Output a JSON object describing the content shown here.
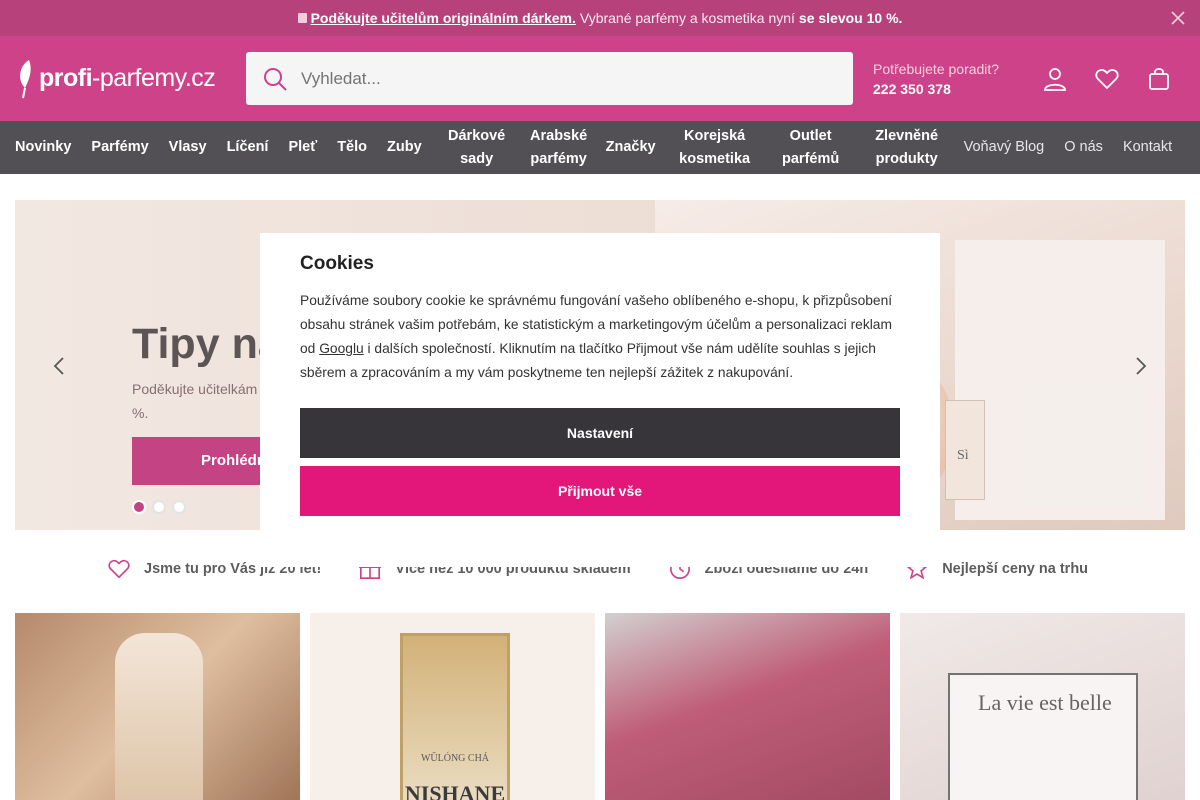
{
  "promo": {
    "lead": "Poděkujte učitelům originálním dárkem.",
    "middle": "Vybrané parfémy a kosmetika nyní",
    "bold": "se slevou 10 %.",
    "gift_icon": "gift-icon",
    "close_icon": "close-icon"
  },
  "header": {
    "logo_part1": "profi",
    "logo_part2": "-parfemy.cz",
    "search_placeholder": "Vyhledat...",
    "help_question": "Potřebujete poradit?",
    "help_phone": "222 350 378",
    "icons": [
      "user-icon",
      "heart-icon",
      "bag-icon"
    ]
  },
  "nav": {
    "items": [
      "Novinky",
      "Parfémy",
      "Vlasy",
      "Líčení",
      "Pleť",
      "Tělo",
      "Zuby",
      "Dárkové sady",
      "Arabské parfémy",
      "Značky",
      "Korejská kosmetika",
      "Outlet parfémů",
      "Zlevněné produkty",
      "Voňavý Blog",
      "O nás",
      "Kontakt"
    ]
  },
  "banner": {
    "title": "Tipy na",
    "subtitle_line1": "Poděkujte učitelkám",
    "subtitle_line2": "%.",
    "cta": "Prohlédn",
    "bottle_label": "Sì",
    "slides": 3,
    "active_slide": 1
  },
  "usp": [
    {
      "icon": "heart-icon",
      "text": "Jsme tu pro Vás již 20 let!"
    },
    {
      "icon": "gift-icon",
      "text": "Více než 10 000 produktů skladem"
    },
    {
      "icon": "clock-icon",
      "text": "Zboží odesíláme do 24h"
    },
    {
      "icon": "star-icon",
      "text": "Nejlepší ceny na trhu"
    }
  ],
  "tiles": {
    "t2_label_small": "WŪLÓNG CHÁ",
    "t2_label_big": "NISHANE",
    "t4_text": "La vie est belle"
  },
  "cookies": {
    "title": "Cookies",
    "text_before_link": "Používáme soubory cookie ke správnému fungování vašeho oblíbeného e-shopu, k přizpůsobení obsahu stránek vašim potřebám, ke statistickým a marketingovým účelům a personalizaci reklam od ",
    "link": "Googlu",
    "text_after_link": " i dalších společností. Kliknutím na tlačítko Přijmout vše nám udělíte souhlas s jejich sběrem a zpracováním a my vám poskytneme ten nejlepší zážitek z nakupování.",
    "settings_button": "Nastavení",
    "accept_button": "Přijmout vše"
  },
  "colors": {
    "brand": "#c4196f",
    "promo_bg": "#a8195e",
    "nav_bg": "#2d2a30",
    "accept": "#e3177a",
    "settings": "#37343a"
  }
}
